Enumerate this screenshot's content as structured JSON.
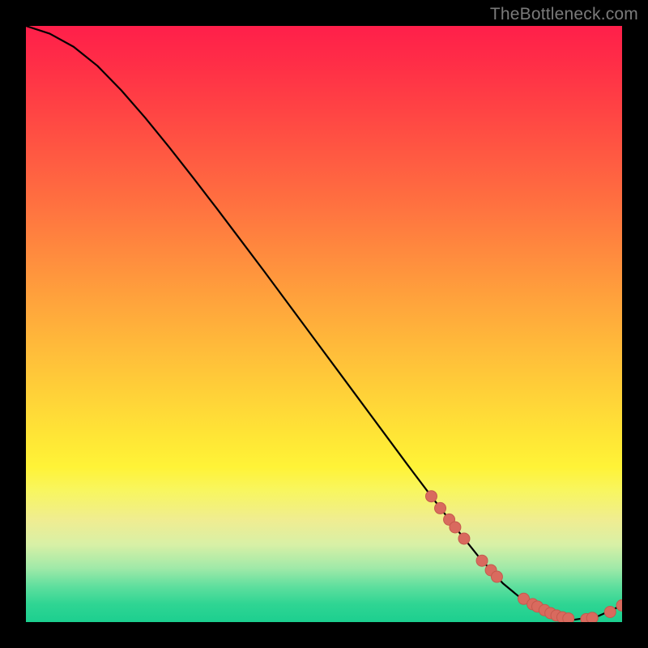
{
  "watermark": "TheBottleneck.com",
  "colors": {
    "curve_stroke": "#000000",
    "marker_fill": "#d96a5e",
    "marker_stroke": "#c55a4e"
  },
  "chart_data": {
    "type": "line",
    "title": "",
    "xlabel": "",
    "ylabel": "",
    "xlim": [
      0,
      100
    ],
    "ylim": [
      0,
      100
    ],
    "curve": {
      "x": [
        0,
        4,
        8,
        12,
        16,
        20,
        24,
        28,
        32,
        36,
        40,
        44,
        48,
        52,
        56,
        60,
        64,
        68,
        72,
        76,
        80,
        84,
        88,
        92,
        96,
        100
      ],
      "y": [
        100,
        98.7,
        96.5,
        93.3,
        89.2,
        84.6,
        79.7,
        74.6,
        69.4,
        64.1,
        58.8,
        53.4,
        48.0,
        42.6,
        37.2,
        31.8,
        26.4,
        21.1,
        15.9,
        10.9,
        6.5,
        3.2,
        1.3,
        0.4,
        1.0,
        2.8
      ]
    },
    "markers": [
      {
        "x": 68.0,
        "y": 21.1
      },
      {
        "x": 69.5,
        "y": 19.1
      },
      {
        "x": 71.0,
        "y": 17.2
      },
      {
        "x": 72.0,
        "y": 15.9
      },
      {
        "x": 73.5,
        "y": 14.0
      },
      {
        "x": 76.5,
        "y": 10.3
      },
      {
        "x": 78.0,
        "y": 8.7
      },
      {
        "x": 79.0,
        "y": 7.6
      },
      {
        "x": 83.5,
        "y": 3.9
      },
      {
        "x": 85.0,
        "y": 3.0
      },
      {
        "x": 85.8,
        "y": 2.6
      },
      {
        "x": 87.0,
        "y": 2.0
      },
      {
        "x": 88.0,
        "y": 1.5
      },
      {
        "x": 89.0,
        "y": 1.1
      },
      {
        "x": 90.0,
        "y": 0.8
      },
      {
        "x": 91.0,
        "y": 0.6
      },
      {
        "x": 94.0,
        "y": 0.5
      },
      {
        "x": 95.0,
        "y": 0.7
      },
      {
        "x": 98.0,
        "y": 1.7
      },
      {
        "x": 100.0,
        "y": 2.8
      }
    ]
  }
}
